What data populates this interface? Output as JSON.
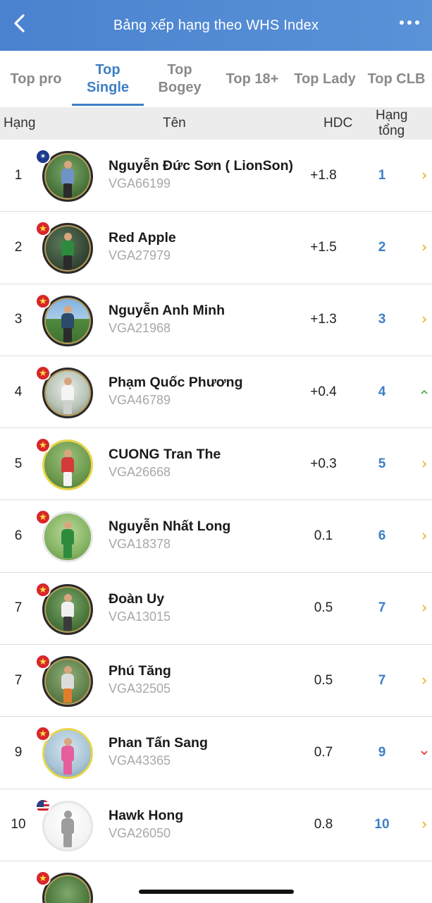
{
  "navbar": {
    "title": "Bảng xếp hạng theo WHS Index",
    "back_icon": "chevron-left-icon",
    "more_icon": "more-horizontal-icon"
  },
  "tabs": [
    {
      "label_line1": "Top pro",
      "label_line2": "",
      "active": false
    },
    {
      "label_line1": "Top",
      "label_line2": "Single",
      "active": true
    },
    {
      "label_line1": "Top",
      "label_line2": "Bogey",
      "active": false
    },
    {
      "label_line1": "Top 18+",
      "label_line2": "",
      "active": false
    },
    {
      "label_line1": "Top Lady",
      "label_line2": "",
      "active": false
    },
    {
      "label_line1": "Top CLB",
      "label_line2": "",
      "active": false
    }
  ],
  "table_header": {
    "rank": "Hạng",
    "name": "Tên",
    "hdc": "HDC",
    "total_line1": "Hạng",
    "total_line2": "tổng"
  },
  "colors": {
    "accent": "#3e7fc6",
    "navbar": "#4a82cf",
    "trend_up": "#4caf50",
    "trend_down": "#e53935",
    "trend_neutral": "#f2b632"
  },
  "rows": [
    {
      "rank": "1",
      "name": "Nguyễn Đức Sơn ( LionSon)",
      "code": "VGA66199",
      "hdc": "+1.8",
      "total": "1",
      "trend": "neutral",
      "flag": "au",
      "avatar": "framed"
    },
    {
      "rank": "2",
      "name": "Red Apple",
      "code": "VGA27979",
      "hdc": "+1.5",
      "total": "2",
      "trend": "neutral",
      "flag": "vn",
      "avatar": "framed"
    },
    {
      "rank": "3",
      "name": "Nguyễn Anh Minh",
      "code": "VGA21968",
      "hdc": "+1.3",
      "total": "3",
      "trend": "neutral",
      "flag": "vn",
      "avatar": "framed"
    },
    {
      "rank": "4",
      "name": "Phạm Quốc Phương",
      "code": "VGA46789",
      "hdc": "+0.4",
      "total": "4",
      "trend": "up",
      "flag": "vn",
      "avatar": "framed"
    },
    {
      "rank": "5",
      "name": "CUONG Tran The",
      "code": "VGA26668",
      "hdc": "+0.3",
      "total": "5",
      "trend": "neutral",
      "flag": "vn",
      "avatar": "yellow"
    },
    {
      "rank": "6",
      "name": "Nguyễn Nhất Long",
      "code": "VGA18378",
      "hdc": "0.1",
      "total": "6",
      "trend": "neutral",
      "flag": "vn",
      "avatar": "plain-photo"
    },
    {
      "rank": "7",
      "name": "Đoàn Uy",
      "code": "VGA13015",
      "hdc": "0.5",
      "total": "7",
      "trend": "neutral",
      "flag": "vn",
      "avatar": "framed"
    },
    {
      "rank": "7",
      "name": "Phú Tăng",
      "code": "VGA32505",
      "hdc": "0.5",
      "total": "7",
      "trend": "neutral",
      "flag": "vn",
      "avatar": "framed"
    },
    {
      "rank": "9",
      "name": "Phan Tấn Sang",
      "code": "VGA43365",
      "hdc": "0.7",
      "total": "9",
      "trend": "down",
      "flag": "vn",
      "avatar": "yellow"
    },
    {
      "rank": "10",
      "name": "Hawk Hong",
      "code": "VGA26050",
      "hdc": "0.8",
      "total": "10",
      "trend": "neutral",
      "flag": "us",
      "avatar": "placeholder"
    }
  ]
}
